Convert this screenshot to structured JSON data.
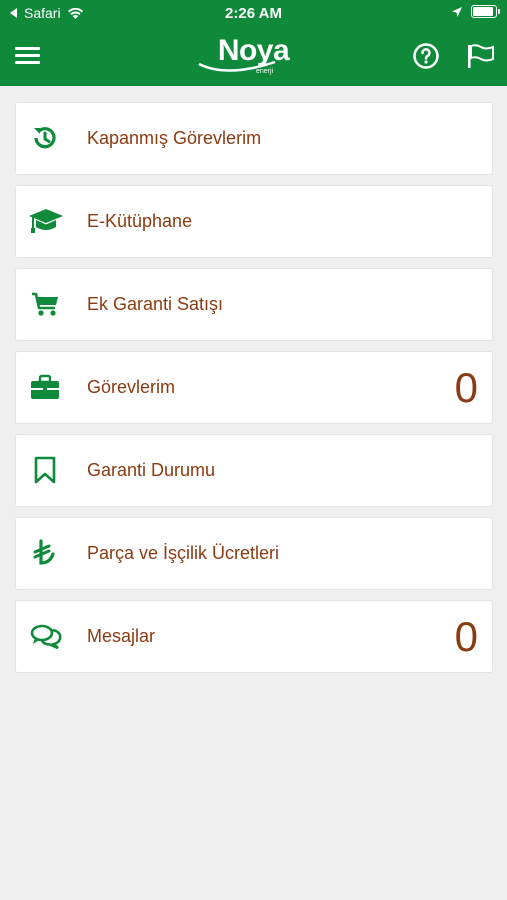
{
  "status_bar": {
    "back_app": "Safari",
    "time": "2:26 AM"
  },
  "header": {
    "logo_text": "Noya",
    "logo_subtext": "enerji"
  },
  "colors": {
    "brand_green": "#0e8a3a",
    "label_brown": "#8a3b12"
  },
  "menu": {
    "items": [
      {
        "label": "Kapanmış Görevlerim",
        "icon": "history-icon",
        "count": null
      },
      {
        "label": "E-Kütüphane",
        "icon": "graduation-cap-icon",
        "count": null
      },
      {
        "label": "Ek Garanti Satışı",
        "icon": "shopping-cart-icon",
        "count": null
      },
      {
        "label": "Görevlerim",
        "icon": "briefcase-icon",
        "count": "0"
      },
      {
        "label": "Garanti Durumu",
        "icon": "bookmark-icon",
        "count": null
      },
      {
        "label": "Parça ve İşçilik Ücretleri",
        "icon": "lira-icon",
        "count": null
      },
      {
        "label": "Mesajlar",
        "icon": "chat-bubbles-icon",
        "count": "0"
      }
    ]
  }
}
